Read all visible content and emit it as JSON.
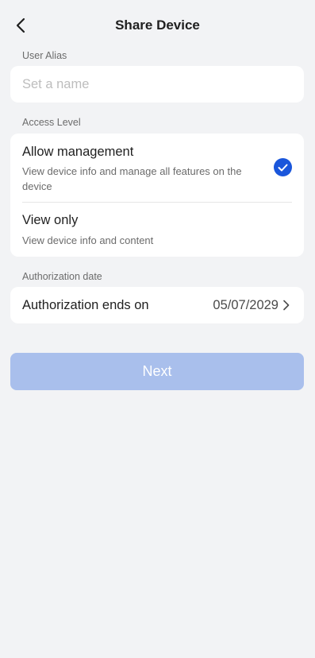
{
  "header": {
    "title": "Share Device",
    "back_icon": "chevron-left-icon"
  },
  "alias": {
    "label": "User Alias",
    "placeholder": "Set a name",
    "value": ""
  },
  "access": {
    "label": "Access Level",
    "options": [
      {
        "title": "Allow management",
        "description": "View device info and manage all features on the device",
        "selected": true
      },
      {
        "title": "View only",
        "description": "View device info and content",
        "selected": false
      }
    ]
  },
  "authorization": {
    "label": "Authorization date",
    "row_label": "Authorization ends on",
    "row_value": "05/07/2029"
  },
  "next_button": {
    "label": "Next",
    "enabled": false
  },
  "colors": {
    "background": "#f2f3f5",
    "card": "#ffffff",
    "accent": "#1a56db",
    "button_disabled": "#a9bfec"
  }
}
